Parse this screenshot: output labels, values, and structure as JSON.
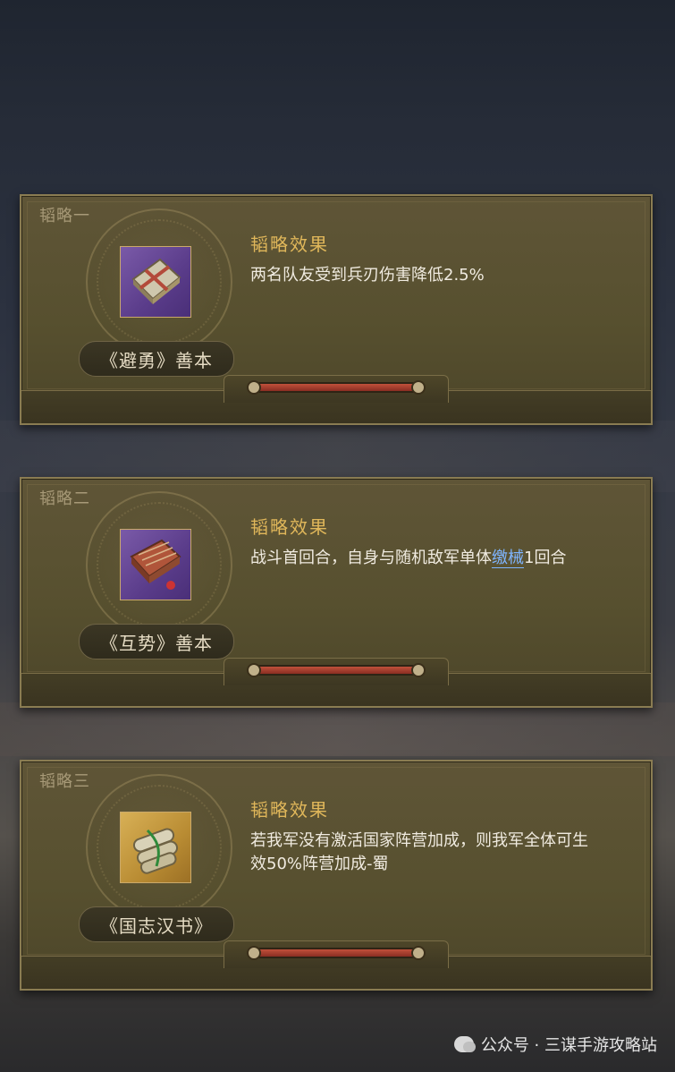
{
  "cards": [
    {
      "tag": "韬略一",
      "book_name": "《避勇》善本",
      "effect_title": "韬略效果",
      "effect_text_parts": [
        "两名队友受到兵刃伤害降低2.5%"
      ],
      "icon": "purple-book-icon"
    },
    {
      "tag": "韬略二",
      "book_name": "《互势》善本",
      "effect_title": "韬略效果",
      "effect_text_parts": [
        "战斗首回合，自身与随机敌军单体",
        "缴械",
        "1回合"
      ],
      "icon": "purple-book-icon"
    },
    {
      "tag": "韬略三",
      "book_name": "《国志汉书》",
      "effect_title": "韬略效果",
      "effect_text_parts": [
        "若我军没有激活国家阵营加成，则我军全体可生效50%阵营加成-蜀"
      ],
      "icon": "gold-scroll-icon"
    }
  ],
  "watermark": {
    "text": "公众号 · 三谋手游攻略站",
    "icon": "wechat-icon"
  },
  "colors": {
    "card_bg": "#57502f",
    "effect_title": "#e0b75a",
    "keyword": "#7fb5ff",
    "purple_icon": "#5a3c8a",
    "gold_icon": "#b98c33"
  }
}
